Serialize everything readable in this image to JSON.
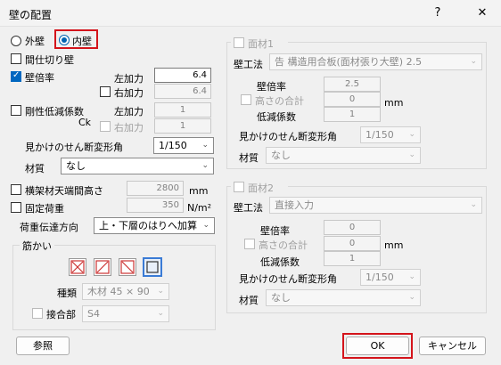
{
  "window": {
    "title": "壁の配置",
    "help_glyph": "?",
    "close_glyph": "✕"
  },
  "wall_side": {
    "outer": "外壁",
    "inner": "内壁",
    "selected": "内壁"
  },
  "partition": {
    "label": "間仕切り壁",
    "checked": false
  },
  "bairitsu": {
    "label": "壁倍率",
    "checked": true,
    "left_label": "左加力",
    "left_value": "6.4",
    "right_label": "右加力",
    "right_value": "6.4",
    "right_checked": false
  },
  "gouseiteigen": {
    "label": "剛性低減係数",
    "ck": "Ck",
    "checked": false,
    "left_label": "左加力",
    "left_value": "1",
    "right_label": "右加力",
    "right_value": "1"
  },
  "deform_angle": {
    "label": "見かけのせん断変形角",
    "value": "1/150"
  },
  "material": {
    "label": "材質",
    "value": "なし"
  },
  "beam_height": {
    "label": "横架材天端間高さ",
    "value": "2800",
    "unit": "mm"
  },
  "fixed_load": {
    "label": "固定荷重",
    "value": "350",
    "unit": "N/m²"
  },
  "load_transfer": {
    "label": "荷重伝達方向",
    "value": "上・下層のはりへ加算"
  },
  "brace": {
    "group_label": "筋かい",
    "type_label": "種類",
    "type_value": "木材 45 × 90",
    "joint_label": "接合部",
    "joint_value": "S4",
    "joint_checked": false
  },
  "panel1": {
    "group_label": "面材1",
    "checked": false,
    "method_label": "壁工法",
    "method_value": "告 構造用合板(面材張り大壁) 2.5",
    "bairitsu_label": "壁倍率",
    "bairitsu_value": "2.5",
    "height_label": "高さの合計",
    "height_value": "0",
    "height_unit": "mm",
    "reduce_label": "低減係数",
    "reduce_value": "1",
    "angle_label": "見かけのせん断変形角",
    "angle_value": "1/150",
    "material_label": "材質",
    "material_value": "なし"
  },
  "panel2": {
    "group_label": "面材2",
    "checked": false,
    "method_label": "壁工法",
    "method_value": "直接入力",
    "bairitsu_label": "壁倍率",
    "bairitsu_value": "0",
    "height_label": "高さの合計",
    "height_value": "0",
    "height_unit": "mm",
    "reduce_label": "低減係数",
    "reduce_value": "1",
    "angle_label": "見かけのせん断変形角",
    "angle_value": "1/150",
    "material_label": "材質",
    "material_value": "なし"
  },
  "buttons": {
    "browse": "参照",
    "ok": "OK",
    "cancel": "キャンセル"
  },
  "colors": {
    "highlight": "#d4141b",
    "accent": "#0067c0"
  }
}
